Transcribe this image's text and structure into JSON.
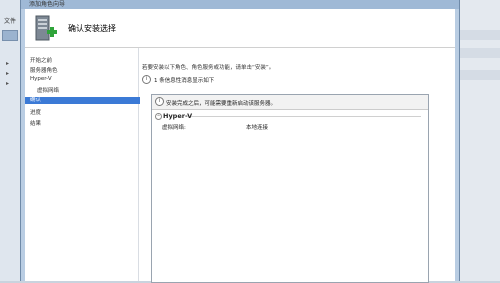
{
  "background": {
    "tab_label": "文件",
    "tree_markers": [
      "▸",
      "▸",
      "▸"
    ]
  },
  "dialog": {
    "titlebar_text": "添加角色向导",
    "page_title": "确认安装选择",
    "nav": [
      {
        "label": "开始之前",
        "selected": false
      },
      {
        "label": "服务器角色",
        "selected": false
      },
      {
        "label": "Hyper-V",
        "selected": false
      },
      {
        "label": "虚拟网络",
        "selected": false
      },
      {
        "label": "确认",
        "selected": true
      },
      {
        "label": "进度",
        "selected": false
      },
      {
        "label": "结果",
        "selected": false
      }
    ],
    "intro_text": "若要安装以下角色、角色服务或功能，请单击“安装”。",
    "info_message": "1 条信息性消息显示如下",
    "notice_text": "安装完成之后，可能需要重新启动该服务器。",
    "section": {
      "toggle": "^",
      "title": "Hyper-V",
      "rows": [
        {
          "label": "虚拟网络:",
          "value": "本地连接"
        }
      ]
    }
  },
  "colors": {
    "selection": "#3b7ad6",
    "frame": "#b9cde3"
  }
}
